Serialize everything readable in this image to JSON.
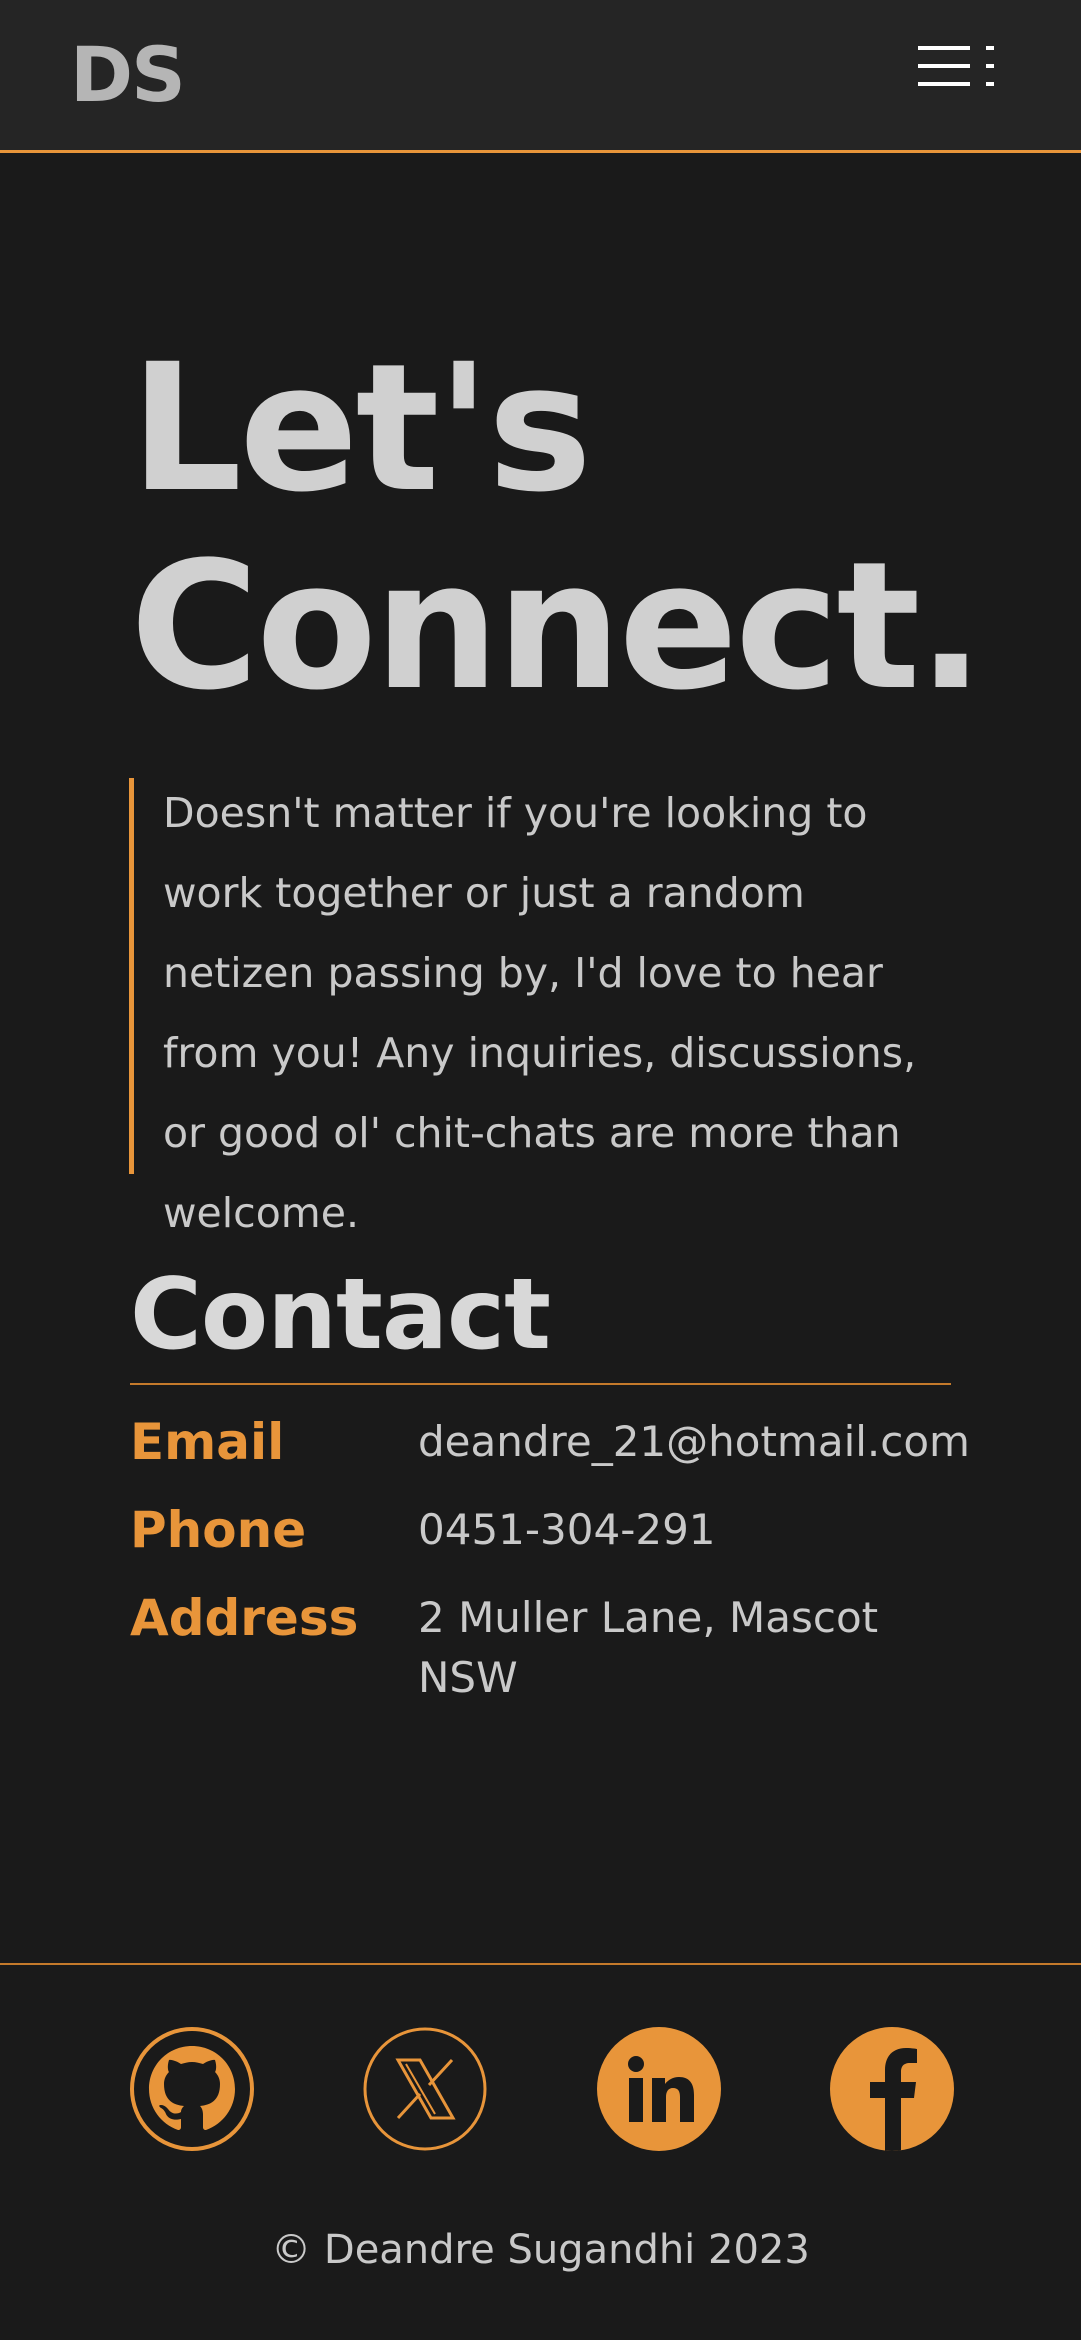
{
  "header": {
    "logo": "DS",
    "menu_icon": "menu-icon"
  },
  "hero": {
    "headline_line1": "Let's",
    "headline_line2": "Connect.",
    "intro": "Doesn't matter if you're looking to work together or just a random netizen passing by, I'd love to hear from you! Any inquiries, discussions, or good ol' chit-chats are more than welcome."
  },
  "contact": {
    "title": "Contact",
    "rows": [
      {
        "label": "Email",
        "value": "deandre_21@hotmail.com"
      },
      {
        "label": "Phone",
        "value": "0451-304-291"
      },
      {
        "label": "Address",
        "value": "2 Muller Lane, Mascot NSW"
      }
    ]
  },
  "footer": {
    "social": [
      {
        "icon": "github-icon"
      },
      {
        "icon": "x-icon"
      },
      {
        "icon": "linkedin-icon"
      },
      {
        "icon": "facebook-icon"
      }
    ],
    "copyright": "© Deandre Sugandhi 2023"
  },
  "colors": {
    "background": "#1a1a1a",
    "header": "#252525",
    "accent": "#e8953a",
    "text": "#c9c9c9"
  }
}
